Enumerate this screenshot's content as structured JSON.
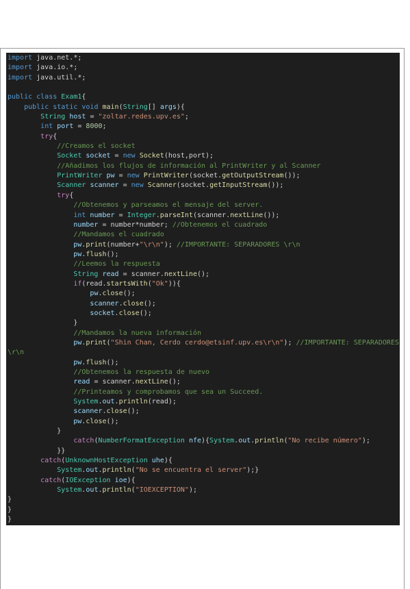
{
  "lines": [
    [
      [
        "kw",
        "import"
      ],
      [
        "pl",
        " java.net.*;"
      ]
    ],
    [
      [
        "kw",
        "import"
      ],
      [
        "pl",
        " java.io.*;"
      ]
    ],
    [
      [
        "kw",
        "import"
      ],
      [
        "pl",
        " java.util.*;"
      ]
    ],
    [],
    [
      [
        "kw",
        "public class"
      ],
      [
        "pl",
        " "
      ],
      [
        "ty",
        "Exam1"
      ],
      [
        "pl",
        "{"
      ]
    ],
    [
      [
        "pl",
        "    "
      ],
      [
        "kw",
        "public static void"
      ],
      [
        "pl",
        " "
      ],
      [
        "fn",
        "main"
      ],
      [
        "pl",
        "("
      ],
      [
        "ty",
        "String"
      ],
      [
        "pl",
        "[] "
      ],
      [
        "id",
        "args"
      ],
      [
        "pl",
        "){"
      ]
    ],
    [
      [
        "pl",
        "        "
      ],
      [
        "ty",
        "String"
      ],
      [
        "pl",
        " "
      ],
      [
        "id",
        "host"
      ],
      [
        "pl",
        " = "
      ],
      [
        "str",
        "\"zoltar.redes.upv.es\""
      ],
      [
        "pl",
        ";"
      ]
    ],
    [
      [
        "pl",
        "        "
      ],
      [
        "kw",
        "int"
      ],
      [
        "pl",
        " "
      ],
      [
        "id",
        "port"
      ],
      [
        "pl",
        " = "
      ],
      [
        "num",
        "8000"
      ],
      [
        "pl",
        ";"
      ]
    ],
    [
      [
        "pl",
        "        "
      ],
      [
        "ctl",
        "try"
      ],
      [
        "pl",
        "{"
      ]
    ],
    [
      [
        "pl",
        "            "
      ],
      [
        "cm",
        "//Creamos el socket"
      ]
    ],
    [
      [
        "pl",
        "            "
      ],
      [
        "ty",
        "Socket"
      ],
      [
        "pl",
        " "
      ],
      [
        "id",
        "socket"
      ],
      [
        "pl",
        " = "
      ],
      [
        "kw",
        "new"
      ],
      [
        "pl",
        " "
      ],
      [
        "fn",
        "Socket"
      ],
      [
        "pl",
        "(host,port);"
      ]
    ],
    [
      [
        "pl",
        "            "
      ],
      [
        "cm",
        "//Añadimos los flujos de información al PrintWriter y al Scanner"
      ]
    ],
    [
      [
        "pl",
        "            "
      ],
      [
        "ty",
        "PrintWriter"
      ],
      [
        "pl",
        " "
      ],
      [
        "id",
        "pw"
      ],
      [
        "pl",
        " = "
      ],
      [
        "kw",
        "new"
      ],
      [
        "pl",
        " "
      ],
      [
        "fn",
        "PrintWriter"
      ],
      [
        "pl",
        "(socket."
      ],
      [
        "fn",
        "getOutputStream"
      ],
      [
        "pl",
        "());"
      ]
    ],
    [
      [
        "pl",
        "            "
      ],
      [
        "ty",
        "Scanner"
      ],
      [
        "pl",
        " "
      ],
      [
        "id",
        "scanner"
      ],
      [
        "pl",
        " = "
      ],
      [
        "kw",
        "new"
      ],
      [
        "pl",
        " "
      ],
      [
        "fn",
        "Scanner"
      ],
      [
        "pl",
        "(socket."
      ],
      [
        "fn",
        "getInputStream"
      ],
      [
        "pl",
        "());"
      ]
    ],
    [
      [
        "pl",
        "            "
      ],
      [
        "ctl",
        "try"
      ],
      [
        "pl",
        "{"
      ]
    ],
    [
      [
        "pl",
        "                "
      ],
      [
        "cm",
        "//Obtenemos y parseamos el mensaje del server."
      ]
    ],
    [
      [
        "pl",
        "                "
      ],
      [
        "kw",
        "int"
      ],
      [
        "pl",
        " "
      ],
      [
        "id",
        "number"
      ],
      [
        "pl",
        " = "
      ],
      [
        "ty",
        "Integer"
      ],
      [
        "pl",
        "."
      ],
      [
        "fn",
        "parseInt"
      ],
      [
        "pl",
        "(scanner."
      ],
      [
        "fn",
        "nextLine"
      ],
      [
        "pl",
        "());"
      ]
    ],
    [
      [
        "pl",
        "                "
      ],
      [
        "id",
        "number"
      ],
      [
        "pl",
        " = number*number; "
      ],
      [
        "cm",
        "//Obtenemos el cuadrado"
      ]
    ],
    [
      [
        "pl",
        "                "
      ],
      [
        "cm",
        "//Mandamos el cuadrado"
      ]
    ],
    [
      [
        "pl",
        "                "
      ],
      [
        "id",
        "pw"
      ],
      [
        "pl",
        "."
      ],
      [
        "fn",
        "print"
      ],
      [
        "pl",
        "(number+"
      ],
      [
        "str",
        "\"\\r\\n\""
      ],
      [
        "pl",
        "); "
      ],
      [
        "cm",
        "//IMPORTANTE: SEPARADORES \\r\\n"
      ]
    ],
    [
      [
        "pl",
        "                "
      ],
      [
        "id",
        "pw"
      ],
      [
        "pl",
        "."
      ],
      [
        "fn",
        "flush"
      ],
      [
        "pl",
        "();"
      ]
    ],
    [
      [
        "pl",
        "                "
      ],
      [
        "cm",
        "//Leemos la respuesta"
      ]
    ],
    [
      [
        "pl",
        "                "
      ],
      [
        "ty",
        "String"
      ],
      [
        "pl",
        " "
      ],
      [
        "id",
        "read"
      ],
      [
        "pl",
        " = scanner."
      ],
      [
        "fn",
        "nextLine"
      ],
      [
        "pl",
        "();"
      ]
    ],
    [
      [
        "pl",
        "                "
      ],
      [
        "ctl",
        "if"
      ],
      [
        "pl",
        "(read."
      ],
      [
        "fn",
        "startsWith"
      ],
      [
        "pl",
        "("
      ],
      [
        "str",
        "\"Ok\""
      ],
      [
        "pl",
        ")){"
      ]
    ],
    [
      [
        "pl",
        "                    "
      ],
      [
        "id",
        "pw"
      ],
      [
        "pl",
        "."
      ],
      [
        "fn",
        "close"
      ],
      [
        "pl",
        "();"
      ]
    ],
    [
      [
        "pl",
        "                    "
      ],
      [
        "id",
        "scanner"
      ],
      [
        "pl",
        "."
      ],
      [
        "fn",
        "close"
      ],
      [
        "pl",
        "();"
      ]
    ],
    [
      [
        "pl",
        "                    "
      ],
      [
        "id",
        "socket"
      ],
      [
        "pl",
        "."
      ],
      [
        "fn",
        "close"
      ],
      [
        "pl",
        "();"
      ]
    ],
    [
      [
        "pl",
        "                }"
      ]
    ],
    [
      [
        "pl",
        "                "
      ],
      [
        "cm",
        "//Mandamos la nueva información"
      ]
    ],
    [
      [
        "pl",
        "                "
      ],
      [
        "id",
        "pw"
      ],
      [
        "pl",
        "."
      ],
      [
        "fn",
        "print"
      ],
      [
        "pl",
        "("
      ],
      [
        "str",
        "\"Shin Chan, Cerdo cerdo@etsinf.upv.es\\r\\n\""
      ],
      [
        "pl",
        "); "
      ],
      [
        "cm",
        "//IMPORTANTE: SEPARADORES"
      ]
    ],
    [
      [
        "cm",
        "\\r\\n"
      ]
    ],
    [
      [
        "pl",
        "                "
      ],
      [
        "id",
        "pw"
      ],
      [
        "pl",
        "."
      ],
      [
        "fn",
        "flush"
      ],
      [
        "pl",
        "();"
      ]
    ],
    [
      [
        "pl",
        "                "
      ],
      [
        "cm",
        "//Obtenemos la respuesta de nuevo"
      ]
    ],
    [
      [
        "pl",
        "                "
      ],
      [
        "id",
        "read"
      ],
      [
        "pl",
        " = scanner."
      ],
      [
        "fn",
        "nextLine"
      ],
      [
        "pl",
        "();"
      ]
    ],
    [
      [
        "pl",
        "                "
      ],
      [
        "cm",
        "//Printeamos y comprobamos que sea un Succeed."
      ]
    ],
    [
      [
        "pl",
        "                "
      ],
      [
        "ty",
        "System"
      ],
      [
        "pl",
        "."
      ],
      [
        "id",
        "out"
      ],
      [
        "pl",
        "."
      ],
      [
        "fn",
        "println"
      ],
      [
        "pl",
        "(read);"
      ]
    ],
    [
      [
        "pl",
        "                "
      ],
      [
        "id",
        "scanner"
      ],
      [
        "pl",
        "."
      ],
      [
        "fn",
        "close"
      ],
      [
        "pl",
        "();"
      ]
    ],
    [
      [
        "pl",
        "                "
      ],
      [
        "id",
        "pw"
      ],
      [
        "pl",
        "."
      ],
      [
        "fn",
        "close"
      ],
      [
        "pl",
        "();"
      ]
    ],
    [
      [
        "pl",
        "            }"
      ]
    ],
    [
      [
        "pl",
        "                "
      ],
      [
        "ctl",
        "catch"
      ],
      [
        "pl",
        "("
      ],
      [
        "ty",
        "NumberFormatException"
      ],
      [
        "pl",
        " "
      ],
      [
        "id",
        "nfe"
      ],
      [
        "pl",
        "){"
      ],
      [
        "ty",
        "System"
      ],
      [
        "pl",
        "."
      ],
      [
        "id",
        "out"
      ],
      [
        "pl",
        "."
      ],
      [
        "fn",
        "println"
      ],
      [
        "pl",
        "("
      ],
      [
        "str",
        "\"No recibe número\""
      ],
      [
        "pl",
        ");"
      ]
    ],
    [
      [
        "pl",
        "            }}"
      ]
    ],
    [
      [
        "pl",
        "        "
      ],
      [
        "ctl",
        "catch"
      ],
      [
        "pl",
        "("
      ],
      [
        "ty",
        "UnknownHostException"
      ],
      [
        "pl",
        " "
      ],
      [
        "id",
        "uhe"
      ],
      [
        "pl",
        "){"
      ]
    ],
    [
      [
        "pl",
        "            "
      ],
      [
        "ty",
        "System"
      ],
      [
        "pl",
        "."
      ],
      [
        "id",
        "out"
      ],
      [
        "pl",
        "."
      ],
      [
        "fn",
        "println"
      ],
      [
        "pl",
        "("
      ],
      [
        "str",
        "\"No se encuentra el server\""
      ],
      [
        "pl",
        ");}"
      ]
    ],
    [
      [
        "pl",
        "        "
      ],
      [
        "ctl",
        "catch"
      ],
      [
        "pl",
        "("
      ],
      [
        "ty",
        "IOException"
      ],
      [
        "pl",
        " "
      ],
      [
        "id",
        "ioe"
      ],
      [
        "pl",
        "){"
      ]
    ],
    [
      [
        "pl",
        "            "
      ],
      [
        "ty",
        "System"
      ],
      [
        "pl",
        "."
      ],
      [
        "id",
        "out"
      ],
      [
        "pl",
        "."
      ],
      [
        "fn",
        "println"
      ],
      [
        "pl",
        "("
      ],
      [
        "str",
        "\"IOEXCEPTION\""
      ],
      [
        "pl",
        ");"
      ]
    ],
    [
      [
        "pl",
        "}"
      ]
    ],
    [
      [
        "pl",
        "}"
      ]
    ],
    [
      [
        "pl",
        "}"
      ]
    ]
  ]
}
